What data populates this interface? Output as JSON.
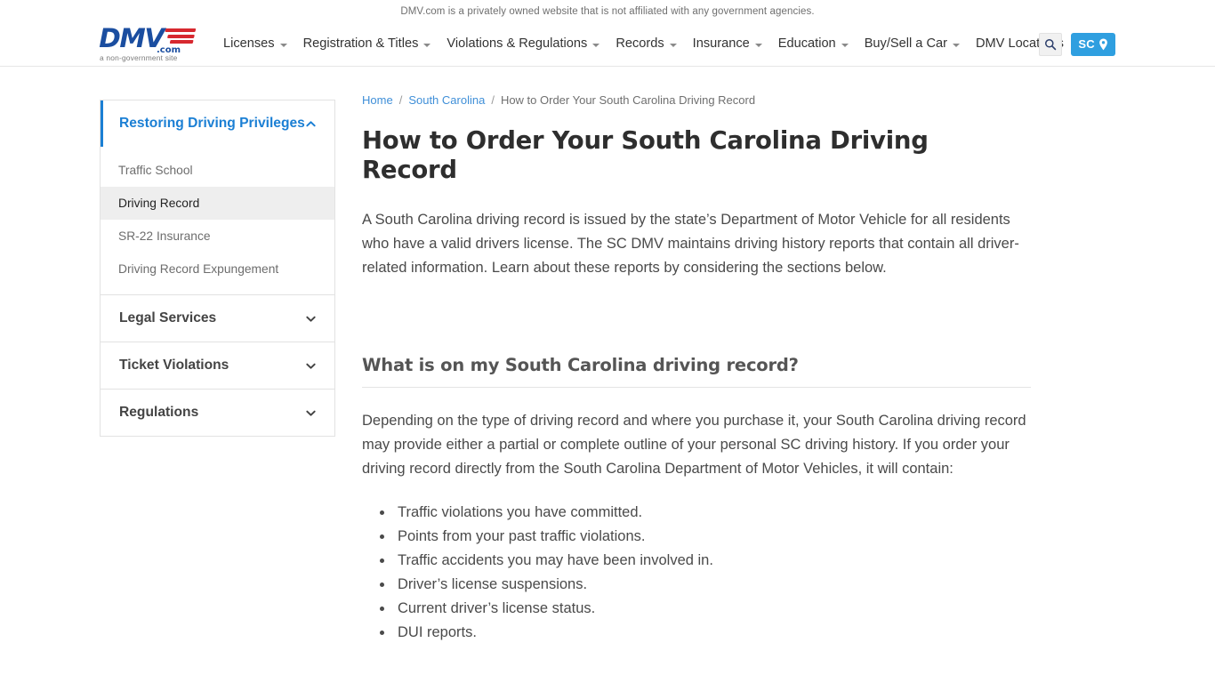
{
  "disclaimer": {
    "text": "DMV.com is a privately owned website that is not affiliated with any government agencies."
  },
  "header": {
    "logo": {
      "wordmark": "DMV",
      "dotcom": ".com",
      "tagline": "a non-government site"
    },
    "nav": [
      {
        "label": "Licenses",
        "has_caret": true
      },
      {
        "label": "Registration & Titles",
        "has_caret": true
      },
      {
        "label": "Violations & Regulations",
        "has_caret": true
      },
      {
        "label": "Records",
        "has_caret": true
      },
      {
        "label": "Insurance",
        "has_caret": true
      },
      {
        "label": "Education",
        "has_caret": true
      },
      {
        "label": "Buy/Sell a Car",
        "has_caret": true
      },
      {
        "label": "DMV Locations",
        "has_caret": false
      }
    ],
    "search_icon": "search-icon",
    "state_button": {
      "label": "SC",
      "icon": "location-pin-icon",
      "color": "#2f9fe0"
    }
  },
  "sidebar": {
    "accent_color": "#1b7fd4",
    "groups": [
      {
        "title": "Restoring Driving Privileges",
        "expanded": true,
        "icon": "chevron-up-icon",
        "links": [
          {
            "label": "Traffic School",
            "current": false
          },
          {
            "label": "Driving Record",
            "current": true
          },
          {
            "label": "SR-22 Insurance",
            "current": false
          },
          {
            "label": "Driving Record Expungement",
            "current": false
          }
        ]
      },
      {
        "title": "Legal Services",
        "expanded": false,
        "icon": "chevron-down-icon",
        "links": []
      },
      {
        "title": "Ticket Violations",
        "expanded": false,
        "icon": "chevron-down-icon",
        "links": []
      },
      {
        "title": "Regulations",
        "expanded": false,
        "icon": "chevron-down-icon",
        "links": []
      }
    ]
  },
  "breadcrumb": {
    "home": "Home",
    "state": "South Carolina",
    "separator": "/",
    "current": "How to Order Your South Carolina Driving Record"
  },
  "main": {
    "title": "How to Order Your South Carolina Driving Record",
    "intro": "A South Carolina driving record is issued by the state’s Department of Motor Vehicle for all residents who have a valid drivers license. The SC DMV maintains driving history reports that contain all driver-related information. Learn about these reports by considering the sections below.",
    "section_heading": "What is on my South Carolina driving record?",
    "section_paragraph": "Depending on the type of driving record and where you purchase it, your South Carolina driving record may provide either a partial or complete outline of your personal SC driving history. If you order your driving record directly from the South Carolina Department of Motor Vehicles, it will contain:",
    "bullets": [
      "Traffic violations you have committed.",
      "Points from your past traffic violations.",
      "Traffic accidents you may have been involved in.",
      "Driver’s license suspensions.",
      "Current driver’s license status.",
      "DUI reports."
    ]
  }
}
